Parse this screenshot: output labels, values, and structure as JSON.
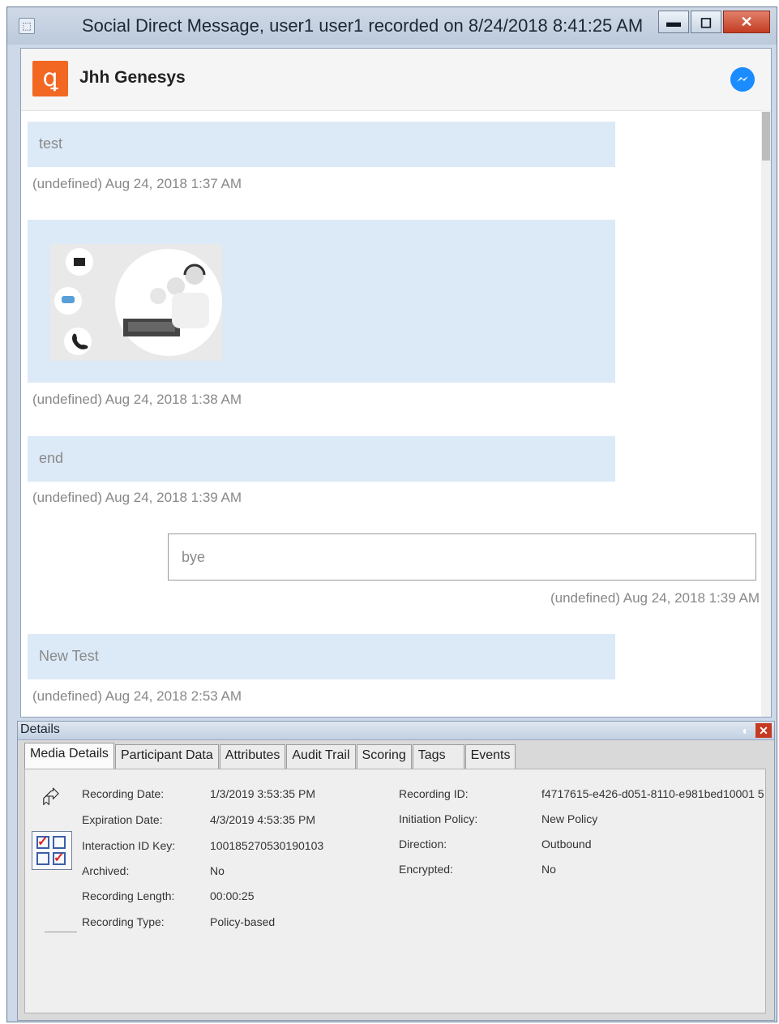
{
  "window": {
    "title": "Social Direct Message, user1 user1 recorded on 8/24/2018 8:41:25 AM",
    "buttons": {
      "minimize": "▬",
      "maximize": "◻",
      "close": "✕"
    }
  },
  "conversation": {
    "header_name": "Jhh Genesys",
    "brand_color": "#f26722",
    "messenger_color": "#1a8cff",
    "messages": [
      {
        "text": "test",
        "timestamp": "(undefined) Aug 24, 2018 1:37 AM"
      },
      {
        "image": "contact-center-agents-image",
        "timestamp": "(undefined) Aug 24, 2018 1:38 AM"
      },
      {
        "text": "end",
        "timestamp": "(undefined) Aug 24, 2018 1:39 AM"
      },
      {
        "text": "bye",
        "timestamp": "(undefined) Aug 24, 2018 1:39 AM",
        "direction": "outgoing"
      },
      {
        "text": "New Test",
        "timestamp": "(undefined) Aug 24, 2018 2:53 AM"
      }
    ]
  },
  "details": {
    "title": "Details",
    "tabs": [
      "Media Details",
      "Participant Data",
      "Attributes",
      "Audit Trail",
      "Scoring",
      "Tags",
      "Events"
    ],
    "active_tab": "Media Details",
    "left_fields": [
      {
        "label": "Recording Date:",
        "value": "1/3/2019 3:53:35 PM"
      },
      {
        "label": "Expiration Date:",
        "value": "4/3/2019 4:53:35 PM"
      },
      {
        "label": "Interaction ID Key:",
        "value": "100185270530190103"
      },
      {
        "label": "Archived:",
        "value": "No"
      },
      {
        "label": "Recording Length:",
        "value": "00:00:25"
      },
      {
        "label": "Recording Type:",
        "value": "Policy-based"
      }
    ],
    "right_fields": [
      {
        "label": "Recording ID:",
        "value": "f4717615-e426-d051-8110-e981bed10001 5"
      },
      {
        "label": "Initiation Policy:",
        "value": "New Policy"
      },
      {
        "label": "Direction:",
        "value": "Outbound"
      },
      {
        "label": "Encrypted:",
        "value": "No"
      }
    ]
  }
}
